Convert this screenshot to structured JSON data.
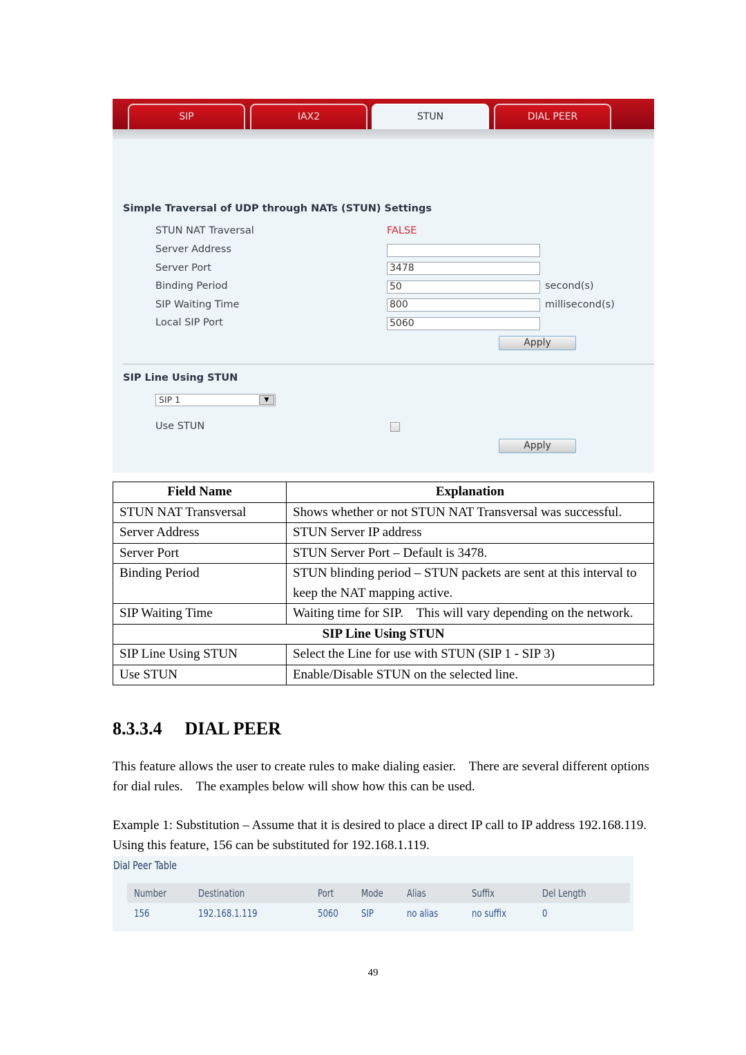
{
  "screenshot": {
    "tabs": [
      {
        "label": "SIP",
        "active": false
      },
      {
        "label": "IAX2",
        "active": false
      },
      {
        "label": "STUN",
        "active": true
      },
      {
        "label": "DIAL PEER",
        "active": false
      }
    ],
    "stun_settings": {
      "title": "Simple Traversal of UDP through NATs (STUN) Settings",
      "fields": [
        {
          "label": "STUN NAT Traversal",
          "value": "FALSE"
        },
        {
          "label": "Server Address",
          "value": ""
        },
        {
          "label": "Server Port",
          "value": "3478"
        },
        {
          "label": "Binding Period",
          "value": "50",
          "unit": "second(s)"
        },
        {
          "label": "SIP Waiting Time",
          "value": "800",
          "unit": "millisecond(s)"
        },
        {
          "label": "Local SIP Port",
          "value": "5060"
        }
      ],
      "apply_label": "Apply"
    },
    "sip_line": {
      "title": "SIP Line Using STUN",
      "selected_line": "SIP 1",
      "use_stun_label": "Use STUN",
      "use_stun_checked": false,
      "apply_label": "Apply"
    },
    "colors": {
      "tab_red": "#c0111a",
      "false_red": "#d8232a",
      "panel_bg": "#eef5f9"
    }
  },
  "field_table": {
    "headers": [
      "Field Name",
      "Explanation"
    ],
    "rows": [
      [
        "STUN NAT Transversal",
        "Shows whether or not STUN NAT Transversal was successful."
      ],
      [
        "Server Address",
        "STUN Server IP address"
      ],
      [
        "Server Port",
        "STUN Server Port – Default is 3478."
      ],
      [
        "Binding Period",
        "STUN blinding period – STUN packets are sent at this interval to keep the NAT mapping active."
      ],
      [
        "SIP Waiting Time",
        "Waiting time for SIP.    This will vary depending on the network."
      ]
    ],
    "section": "SIP Line Using STUN",
    "rows2": [
      [
        "SIP Line Using STUN",
        "Select the Line for use with STUN (SIP 1 - SIP 3)"
      ],
      [
        "Use STUN",
        "Enable/Disable STUN on the selected line."
      ]
    ]
  },
  "section": {
    "number": "8.3.3.4",
    "title": "DIAL PEER",
    "para1": "This feature allows the user to create rules to make dialing easier.    There are several different options for dial rules.    The examples below will show how this can be used.",
    "para2": "Example 1: Substitution – Assume that it is desired to place a direct IP call to IP address 192.168.119.    Using this feature, 156 can be substituted for 192.168.1.119."
  },
  "dial_peer_table": {
    "title": "Dial Peer Table",
    "headers": [
      "Number",
      "Destination",
      "Port",
      "Mode",
      "Alias",
      "Suffix",
      "Del Length"
    ],
    "rows": [
      [
        "156",
        "192.168.1.119",
        "5060",
        "SIP",
        "no alias",
        "no suffix",
        "0"
      ]
    ]
  },
  "page_number": "49"
}
